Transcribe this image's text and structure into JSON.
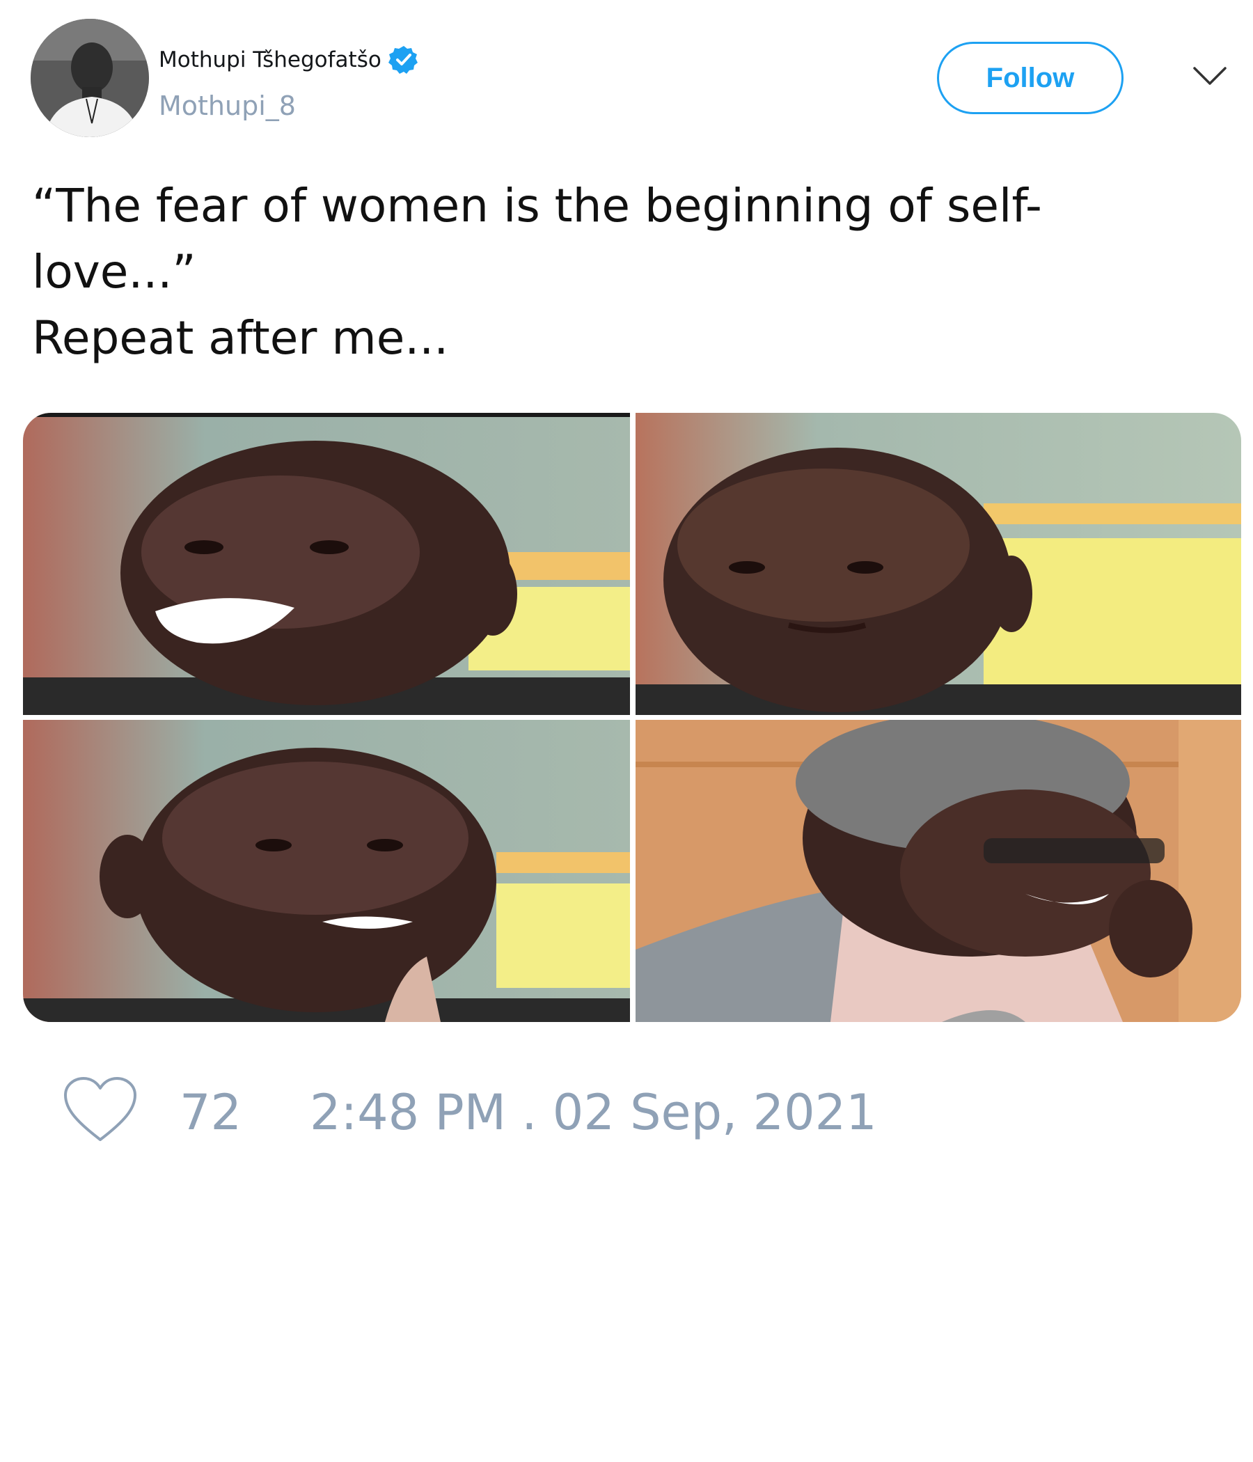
{
  "author": {
    "display_name": "Mothupi Tšhegofatšo",
    "handle": "Mothupi_8",
    "verified": true,
    "avatar_icon": "profile-photo"
  },
  "header": {
    "follow_label": "Follow",
    "menu_icon": "chevron-down-icon"
  },
  "tweet": {
    "text_lines": [
      "“The fear of women is the beginning of self-",
      "love...”",
      "Repeat after me..."
    ]
  },
  "media": {
    "images": [
      {
        "description_icon": "man-shouting-photo"
      },
      {
        "description_icon": "man-staring-photo"
      },
      {
        "description_icon": "man-grimacing-photo"
      },
      {
        "description_icon": "man-laughing-glasses-photo"
      }
    ]
  },
  "footer": {
    "like_icon": "heart-icon",
    "like_count": "72",
    "timestamp": "2:48 PM . 02 Sep, 2021"
  },
  "colors": {
    "accent": "#1da1f2",
    "muted": "#8fa1b6",
    "text": "#14171a",
    "background": "#ffffff"
  }
}
